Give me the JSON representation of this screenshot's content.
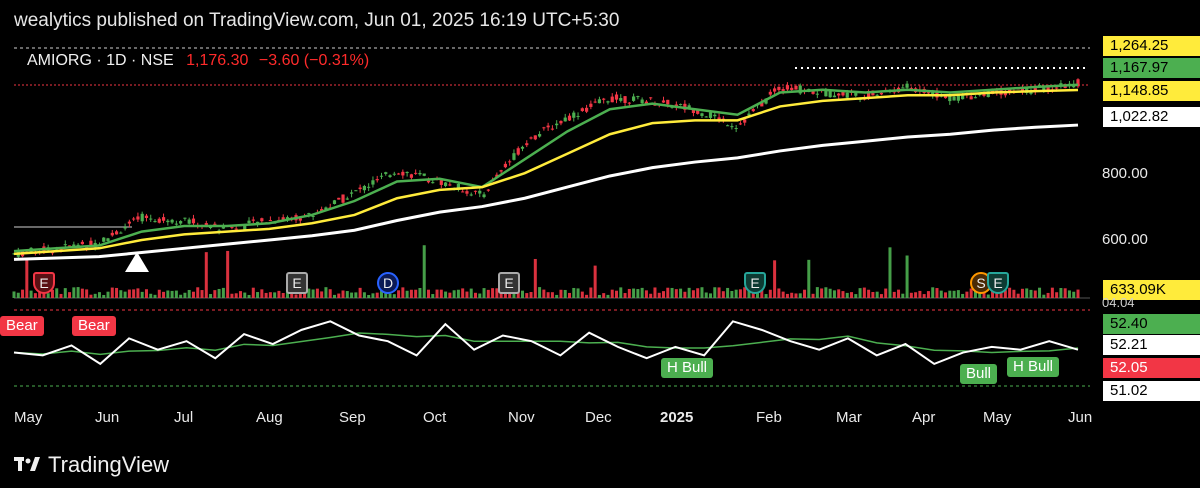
{
  "header": {
    "publisher_line": "wealytics published on TradingView.com, Jun 01, 2025 16:19 UTC+5:30"
  },
  "symbol": {
    "ticker_line": "AMIORG · 1D · NSE",
    "price": "1,176.30",
    "change": "−3.60 (−0.31%)"
  },
  "price_labels": [
    {
      "text": "1,264.25",
      "bg": "#ffeb3b",
      "fg": "#000000"
    },
    {
      "text": "1,167.97",
      "bg": "#4caf50",
      "fg": "#000000"
    },
    {
      "text": "1,148.85",
      "bg": "#ffeb3b",
      "fg": "#000000"
    },
    {
      "text": "1,022.82",
      "bg": "#ffffff",
      "fg": "#000000"
    }
  ],
  "volume_label": {
    "text": "633.09K",
    "bg": "#ffeb3b"
  },
  "rsi_labels": [
    {
      "text": "52.40",
      "bg": "#4caf50",
      "fg": "#000000"
    },
    {
      "text": "52.21",
      "bg": "#ffffff",
      "fg": "#000000"
    },
    {
      "text": "52.05",
      "bg": "#f23645",
      "fg": "#ffffff"
    },
    {
      "text": "51.02",
      "bg": "#ffffff",
      "fg": "#000000"
    }
  ],
  "hidden_label_fragment": "04.04",
  "divergence_labels": [
    {
      "text": "Bear",
      "type": "bear"
    },
    {
      "text": "Bear",
      "type": "bear"
    },
    {
      "text": "H Bull",
      "type": "bull"
    },
    {
      "text": "Bull",
      "type": "bull"
    },
    {
      "text": "H Bull",
      "type": "bull"
    }
  ],
  "events": [
    "E",
    "E",
    "D",
    "E",
    "E",
    "S",
    "E"
  ],
  "colors": {
    "up": "#4caf50",
    "down": "#f23645",
    "ema_fast": "#4caf50",
    "ema_mid": "#ffeb3b",
    "ema_slow": "#ffffff",
    "rsi": "#ffffff",
    "rsi_ma": "#4caf50"
  },
  "footer": {
    "brand": "TradingView"
  },
  "chart_data": {
    "type": "line",
    "symbol": "AMIORG",
    "interval": "1D",
    "exchange": "NSE",
    "x_ticks": [
      "May",
      "Jun",
      "Jul",
      "Aug",
      "Sep",
      "Oct",
      "Nov",
      "Dec",
      "2025",
      "Feb",
      "Mar",
      "Apr",
      "May",
      "Jun"
    ],
    "y_ticks": [
      "800.00",
      "600.00"
    ],
    "ylim": [
      520,
      1300
    ],
    "series": [
      {
        "name": "",
        "values": [
          560,
          580,
          600,
          690,
          680,
          650,
          680,
          700,
          780,
          860,
          820,
          770,
          960,
          1050,
          1120,
          1110,
          1080,
          1020,
          1160,
          1140,
          1130,
          1160,
          1120,
          1140,
          1150,
          1176
        ]
      },
      {
        "name": "",
        "values": [
          570,
          580,
          590,
          640,
          660,
          660,
          670,
          700,
          750,
          820,
          830,
          800,
          900,
          1000,
          1080,
          1100,
          1080,
          1060,
          1140,
          1150,
          1140,
          1150,
          1140,
          1150,
          1160,
          1168
        ]
      },
      {
        "name": "",
        "values": [
          560,
          570,
          580,
          610,
          630,
          640,
          650,
          670,
          700,
          760,
          790,
          800,
          850,
          920,
          990,
          1030,
          1040,
          1040,
          1090,
          1110,
          1120,
          1130,
          1130,
          1140,
          1145,
          1149
        ]
      },
      {
        "name": "",
        "values": [
          540,
          545,
          550,
          565,
          580,
          595,
          610,
          625,
          645,
          680,
          710,
          730,
          760,
          800,
          840,
          870,
          890,
          905,
          930,
          950,
          965,
          980,
          990,
          1005,
          1015,
          1023
        ]
      }
    ],
    "rsi": {
      "ylim": [
        25,
        80
      ],
      "values": [
        50,
        48,
        55,
        42,
        60,
        52,
        58,
        46,
        63,
        56,
        66,
        72,
        62,
        58,
        48,
        70,
        52,
        62,
        58,
        48,
        64,
        54,
        46,
        54,
        48,
        72,
        66,
        58,
        52,
        60,
        48,
        56,
        42,
        50,
        54,
        52,
        58,
        52
      ]
    }
  }
}
